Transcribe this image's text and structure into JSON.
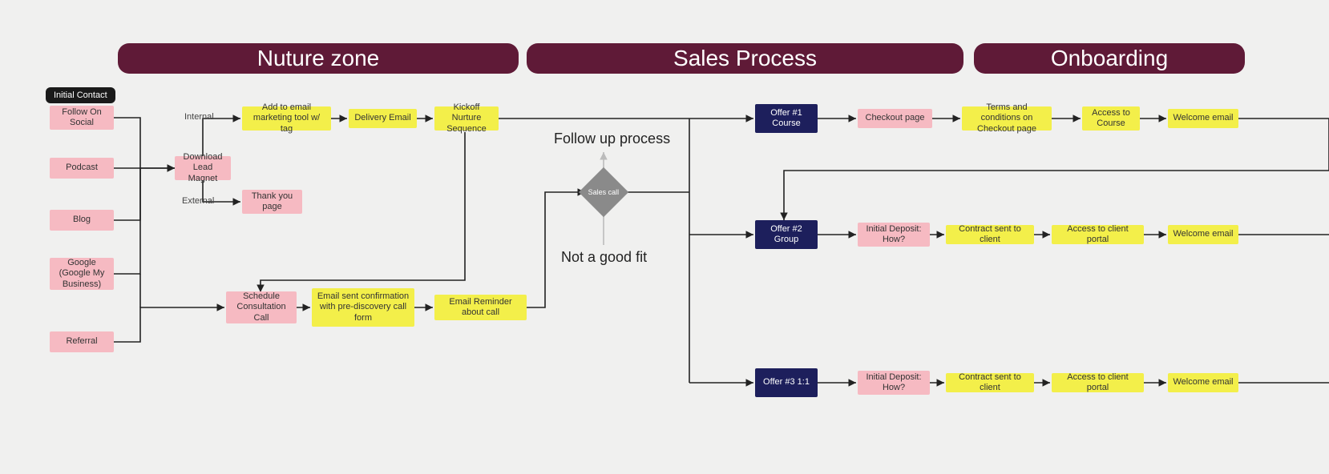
{
  "zones": {
    "nurture": "Nuture zone",
    "sales": "Sales Process",
    "onboarding": "Onboarding"
  },
  "tag": {
    "initial_contact": "Initial Contact"
  },
  "sources": {
    "social": "Follow On Social",
    "podcast": "Podcast",
    "blog": "Blog",
    "google": "Google (Google My Business)",
    "referral": "Referral"
  },
  "nurture": {
    "download_magnet": "Download Lead Magnet",
    "internal": "Internal",
    "external": "External",
    "add_email_tool": "Add to email marketing tool w/ tag",
    "delivery_email": "Delivery Email",
    "kickoff_nurture": "Kickoff Nurture Sequence",
    "thank_you": "Thank you page",
    "schedule_call": "Schedule Consultation Call",
    "confirm_email": "Email sent confirmation with pre-discovery call form",
    "reminder_email": "Email Reminder about call"
  },
  "sales": {
    "followup": "Follow up process",
    "sales_call": "Sales call",
    "not_fit": "Not a good fit",
    "offer1": "Offer #1 Course",
    "offer2": "Offer #2 Group",
    "offer3": "Offer #3 1:1"
  },
  "onboarding": {
    "r1": {
      "checkout": "Checkout page",
      "terms": "Terms and conditions on Checkout page",
      "access": "Access to Course",
      "welcome": "Welcome email"
    },
    "r2": {
      "deposit": "Initial Deposit: How?",
      "contract": "Contract sent to client",
      "portal": "Access to client portal",
      "welcome": "Welcome email"
    },
    "r3": {
      "deposit": "Initial Deposit: How?",
      "contract": "Contract sent to client",
      "portal": "Access to client portal",
      "welcome": "Welcome email"
    }
  }
}
